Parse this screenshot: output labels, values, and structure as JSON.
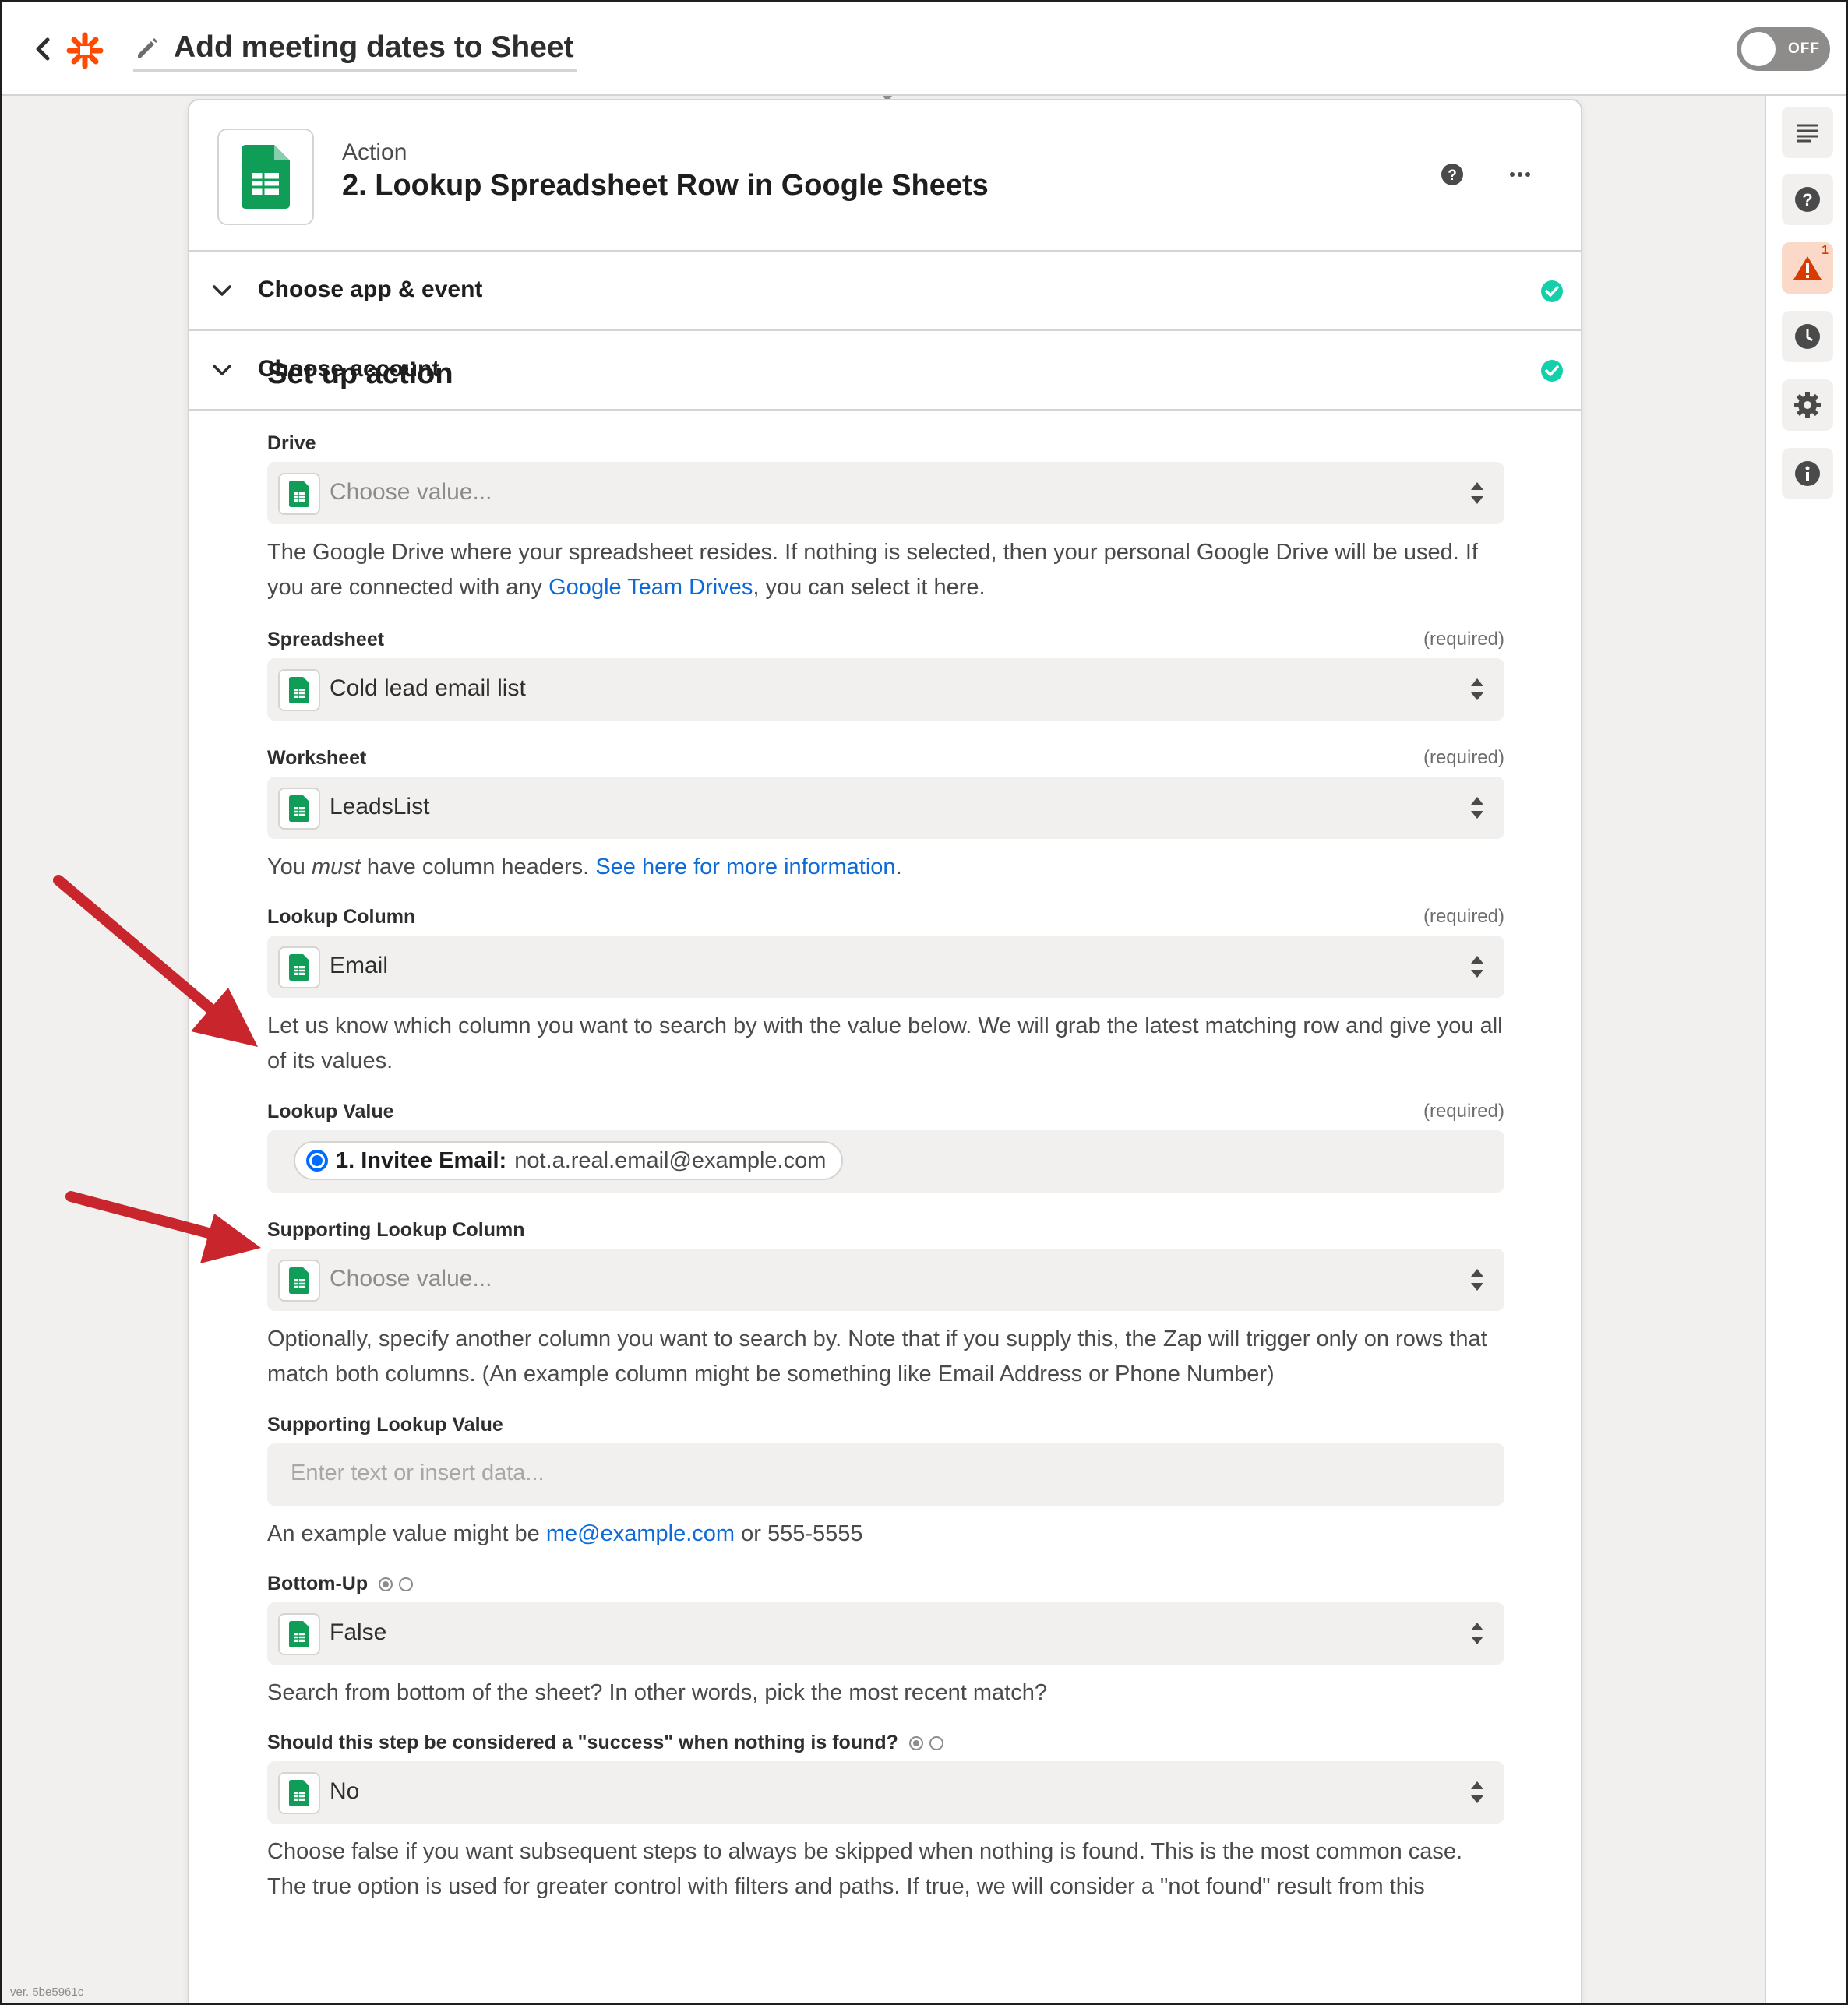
{
  "header": {
    "zap_title": "Add meeting dates to Sheet",
    "toggle_label": "OFF"
  },
  "step": {
    "kind": "Action",
    "title": "2. Lookup Spreadsheet Row in Google Sheets"
  },
  "sections": [
    {
      "label": "Choose app & event",
      "status": "complete"
    },
    {
      "label": "Choose account",
      "status": "complete"
    }
  ],
  "setup": {
    "title": "Set up action",
    "required_label": "(required)",
    "drive": {
      "label": "Drive",
      "placeholder": "Choose value...",
      "help_before": "The Google Drive where your spreadsheet resides. If nothing is selected, then your personal Google Drive will be used. If you are connected with any ",
      "help_link": "Google Team Drives",
      "help_after": ", you can select it here."
    },
    "spreadsheet": {
      "label": "Spreadsheet",
      "value": "Cold lead email list"
    },
    "worksheet": {
      "label": "Worksheet",
      "value": "LeadsList",
      "help_before": "You ",
      "help_em": "must",
      "help_mid": " have column headers. ",
      "help_link": "See here for more information",
      "help_after": "."
    },
    "lookup_column": {
      "label": "Lookup Column",
      "value": "Email",
      "help": "Let us know which column you want to search by with the value below. We will grab the latest matching row and give you all of its values."
    },
    "lookup_value": {
      "label": "Lookup Value",
      "pill_key": "1. Invitee Email:",
      "pill_value": "not.a.real.email@example.com"
    },
    "supporting_column": {
      "label": "Supporting Lookup Column",
      "placeholder": "Choose value...",
      "help": "Optionally, specify another column you want to search by. Note that if you supply this, the Zap will trigger only on rows that match both columns. (An example column might be something like Email Address or Phone Number)"
    },
    "supporting_value": {
      "label": "Supporting Lookup Value",
      "placeholder": "Enter text or insert data...",
      "help_before": "An example value might be ",
      "help_link": "me@example.com",
      "help_after": " or 555-5555"
    },
    "bottom_up": {
      "label": "Bottom-Up",
      "value": "False",
      "help": "Search from bottom of the sheet? In other words, pick the most recent match?"
    },
    "success_not_found": {
      "label": "Should this step be considered a \"success\" when nothing is found?",
      "value": "No",
      "help_line1": "Choose false if you want subsequent steps to always be skipped when nothing is found. This is the most common case.",
      "help_line2": "The true option is used for greater control with filters and paths. If true, we will consider a \"not found\" result from this"
    }
  },
  "sidebar_icons": [
    "list-icon",
    "help-icon",
    "warning-icon",
    "clock-icon",
    "gear-icon",
    "info-icon"
  ],
  "warning_count": "1",
  "version": "ver. 5be5961c",
  "colors": {
    "brand": "#ff4a00",
    "sheets_green": "#0f9d58",
    "check_teal": "#13d0ab",
    "link": "#0d6ad6",
    "annotation_arrow": "#c8262c"
  }
}
